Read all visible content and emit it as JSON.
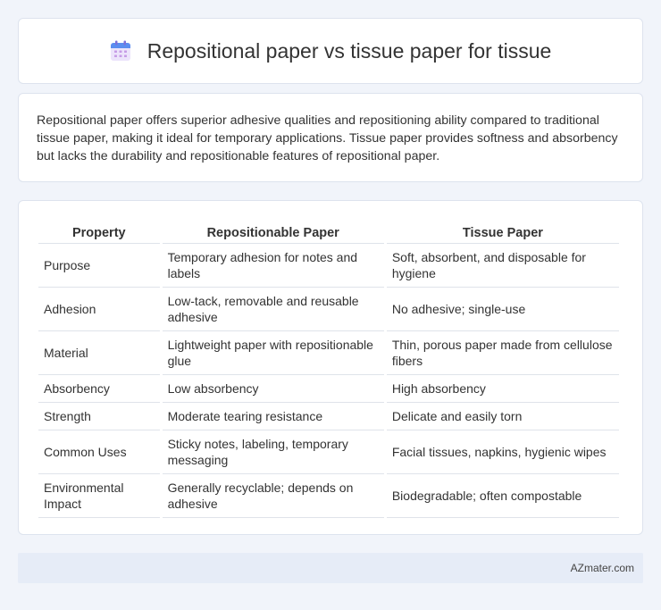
{
  "header": {
    "icon": "calendar-icon",
    "title": "Repositional paper vs tissue paper for tissue"
  },
  "intro": {
    "text": "Repositional paper offers superior adhesive qualities and repositioning ability compared to traditional tissue paper, making it ideal for temporary applications. Tissue paper provides softness and absorbency but lacks the durability and repositionable features of repositional paper."
  },
  "table": {
    "headers": [
      "Property",
      "Repositionable Paper",
      "Tissue Paper"
    ],
    "rows": [
      [
        "Purpose",
        "Temporary adhesion for notes and labels",
        "Soft, absorbent, and disposable for hygiene"
      ],
      [
        "Adhesion",
        "Low-tack, removable and reusable adhesive",
        "No adhesive; single-use"
      ],
      [
        "Material",
        "Lightweight paper with repositionable glue",
        "Thin, porous paper made from cellulose fibers"
      ],
      [
        "Absorbency",
        "Low absorbency",
        "High absorbency"
      ],
      [
        "Strength",
        "Moderate tearing resistance",
        "Delicate and easily torn"
      ],
      [
        "Common Uses",
        "Sticky notes, labeling, temporary messaging",
        "Facial tissues, napkins, hygienic wipes"
      ],
      [
        "Environmental Impact",
        "Generally recyclable; depends on adhesive",
        "Biodegradable; often compostable"
      ]
    ]
  },
  "footer": {
    "brand": "AZmater.com"
  },
  "colors": {
    "background": "#f1f4fa",
    "card": "#ffffff",
    "footer_bar": "#e6ecf7"
  }
}
